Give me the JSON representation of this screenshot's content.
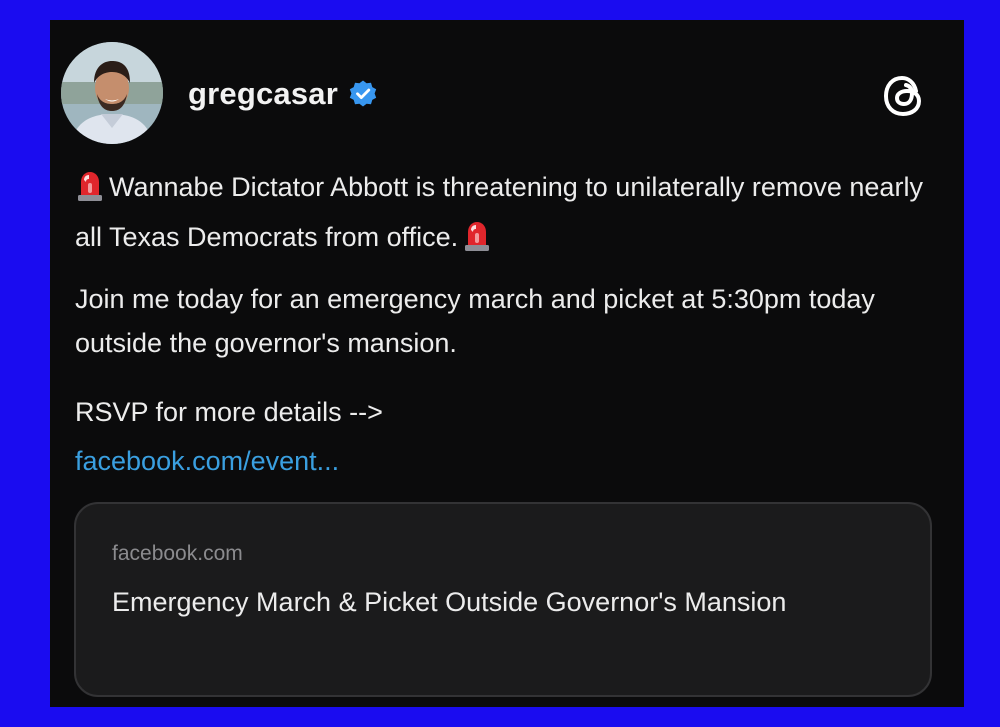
{
  "post": {
    "username": "gregcasar",
    "paragraphs": [
      "Wannabe Dictator Abbott is threatening to unilaterally remove nearly all Texas Democrats from office.",
      "Join me today for an emergency march and picket at 5:30pm today outside the governor's mansion.",
      "RSVP for more details -->"
    ],
    "link_text": "facebook.com/event...",
    "icons": {
      "verified": "verified-badge-icon",
      "brand": "threads-logo-icon",
      "emoji": "police-siren-emoji-icon"
    }
  },
  "link_card": {
    "domain": "facebook.com",
    "title": "Emergency March & Picket Outside Governor's Mansion"
  },
  "colors": {
    "frame": "#1a0cf0",
    "background": "#0b0b0c",
    "link": "#3a9fe0",
    "verified": "#3897f0",
    "card_bg": "#1b1b1c"
  }
}
